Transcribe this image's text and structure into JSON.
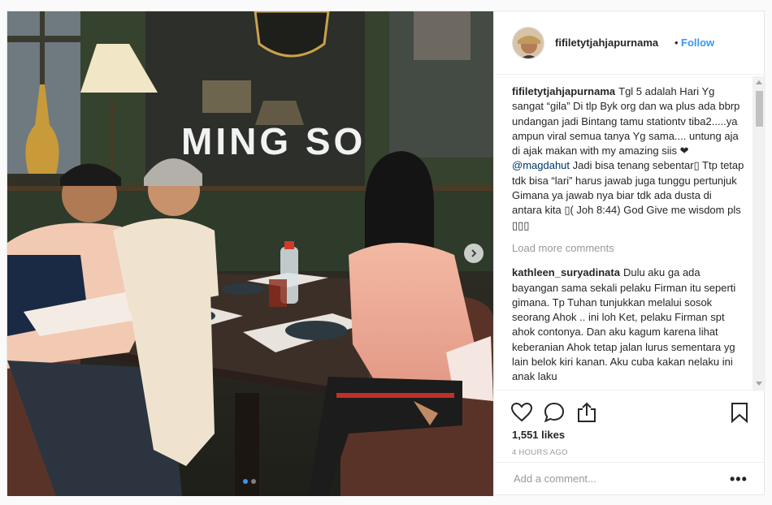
{
  "post": {
    "username": "fifiletytjahjapurnama",
    "follow_label": "Follow",
    "header_separator": "•",
    "sign_text": "MING SO",
    "comments": [
      {
        "username": "fifiletytjahjapurnama",
        "text_before": "Tgl 5 adalah Hari Yg sangat “gila” Di tlp Byk org dan wa plus ada bbrp undangan jadi Bintang tamu stationtv tiba2.....ya ampun viral semua tanya Yg sama.... untung aja di ajak makan with my amazing siis ❤ ",
        "mention": "@magdahut",
        "text_after": " Jadi bisa tenang sebentar▯ Ttp tetap tdk bisa “lari” harus jawab juga tunggu pertunjuk Gimana ya jawab nya biar tdk ada dusta di antara kita ▯( Joh 8:44) God Give me wisdom pls ▯▯▯"
      },
      {
        "username": "kathleen_suryadinata",
        "text": "Dulu aku ga ada bayangan sama sekali pelaku Firman itu seperti gimana. Tp Tuhan tunjukkan melalui sosok seorang Ahok .. ini loh Ket, pelaku Firman spt ahok contonya. Dan aku kagum karena lihat keberanian Ahok tetap jalan lurus sementara yg lain belok kiri kanan. Aku cuba kakan nelaku ini anak laku"
      }
    ],
    "load_more_label": "Load more comments",
    "likes": "1,551 likes",
    "timestamp": "4 HOURS AGO",
    "add_comment_placeholder": "Add a comment...",
    "more_label": "•••"
  },
  "icons": {
    "like": "heart-icon",
    "comment": "comment-icon",
    "share": "share-icon",
    "save": "bookmark-icon",
    "next": "chevron-right-icon"
  },
  "colors": {
    "link_blue": "#3897f0",
    "muted": "#999999",
    "text": "#262626"
  },
  "carousel": {
    "count": 2,
    "active": 1
  }
}
